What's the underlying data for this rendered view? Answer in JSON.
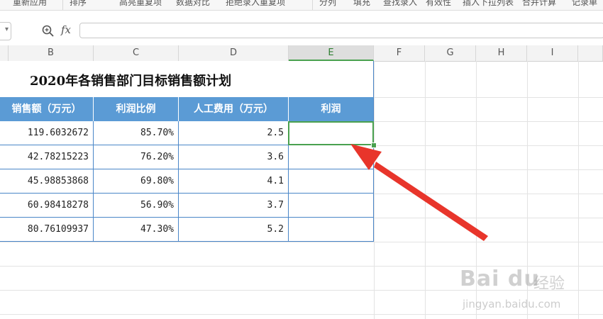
{
  "toolbar": {
    "items": [
      "重新应用",
      "排序",
      "高亮重复项",
      "数据对比",
      "拒绝录入重复项",
      "分列",
      "填充",
      "查找录入",
      "有效性",
      "插入下拉列表",
      "合并计算",
      "记录单"
    ]
  },
  "formula_bar": {
    "fx_label": "fx",
    "value": ""
  },
  "columns": [
    "B",
    "C",
    "D",
    "E",
    "F",
    "G",
    "H",
    "I"
  ],
  "active_column": "E",
  "sheet": {
    "title": "2020年各销售部门目标销售额计划",
    "headers": [
      "销售额（万元）",
      "利润比例",
      "人工费用（万元）",
      "利润"
    ],
    "rows": [
      [
        "119.6032672",
        "85.70%",
        "2.5",
        ""
      ],
      [
        "42.78215223",
        "76.20%",
        "3.6",
        ""
      ],
      [
        "45.98853868",
        "69.80%",
        "4.1",
        ""
      ],
      [
        "60.98418278",
        "56.90%",
        "3.7",
        ""
      ],
      [
        "80.76109937",
        "47.30%",
        "5.2",
        ""
      ]
    ]
  },
  "colors": {
    "header_fill": "#5b9bd5",
    "table_border": "#4a86c8",
    "selection": "#4aa14f",
    "arrow": "#e8352b"
  },
  "watermark": {
    "brand": "Bai du",
    "jingyan": "经验",
    "url": "jingyan.baidu.com"
  }
}
